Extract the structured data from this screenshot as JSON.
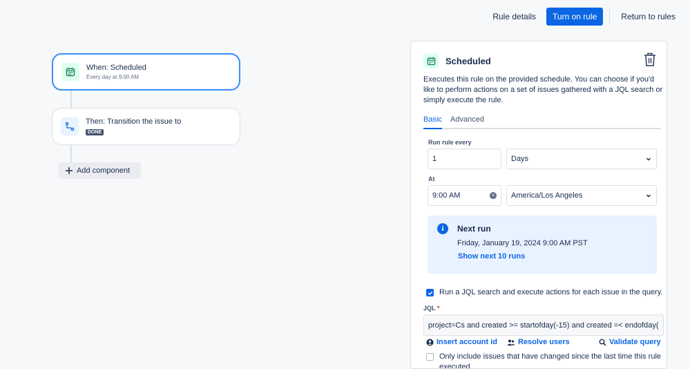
{
  "topbar": {
    "rule_details": "Rule details",
    "turn_on": "Turn on rule",
    "return": "Return to rules"
  },
  "canvas": {
    "trigger": {
      "title": "When: Scheduled",
      "subtitle": "Every day at 9:00 AM",
      "icon": "calendar-icon"
    },
    "action": {
      "title": "Then: Transition the issue to",
      "status": "DONE",
      "icon": "transition-icon"
    },
    "add_component": "Add component"
  },
  "panel": {
    "title": "Scheduled",
    "description": "Executes this rule on the provided schedule. You can choose if you'd like to perform actions on a set of issues gathered with a JQL search or simply execute the rule.",
    "tabs": [
      "Basic",
      "Advanced"
    ],
    "run_every_label": "Run rule every",
    "run_every_value": "1",
    "unit_value": "Days",
    "at_label": "At",
    "time_value": "9:00 AM",
    "timezone_value": "America/Los Angeles",
    "next_run": {
      "title": "Next run",
      "date": "Friday, January 19, 2024 9:00 AM PST",
      "link": "Show next 10 runs"
    },
    "jql_checkbox_label": "Run a JQL search and execute actions for each issue in the query.",
    "jql_label": "JQL",
    "jql_required_mark": "*",
    "jql_value": "project=Cs and created >= startofday(-15) and created =< endofday(",
    "insert_account": "Insert account id",
    "resolve_users": "Resolve users",
    "validate_query": "Validate query",
    "only_include_label": "Only include issues that have changed since the last time this rule executed"
  },
  "colors": {
    "accent": "#0c66e4",
    "trigger_bg": "#dcfff1",
    "action_bg": "#e9f2ff"
  }
}
